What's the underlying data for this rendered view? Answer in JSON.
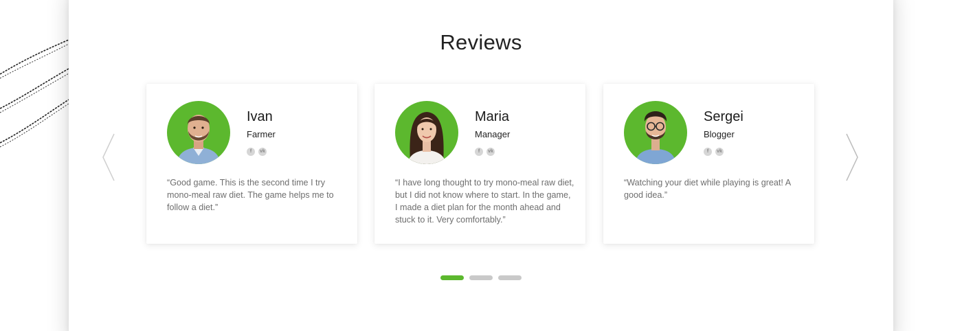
{
  "section": {
    "title": "Reviews"
  },
  "colors": {
    "accent": "#5cb82e",
    "dot_inactive": "#c9c9c9",
    "quote_text": "#6e6e6e",
    "social_icon_bg": "#d6d6d6"
  },
  "reviews": [
    {
      "name": "Ivan",
      "role": "Farmer",
      "quote": "“Good game. This is the second time I try mono-meal raw diet. The game helps me to follow a diet.”",
      "social": [
        "f",
        "vk"
      ]
    },
    {
      "name": "Maria",
      "role": "Manager",
      "quote": "“I have long thought to try mono-meal raw diet, but I did not know where to start. In the game, I made a diet plan for the month ahead and stuck to it. Very comfortably.”",
      "social": [
        "f",
        "vk"
      ]
    },
    {
      "name": "Sergei",
      "role": "Blogger",
      "quote": "“Watching your diet while playing is great! A good idea.”",
      "social": [
        "f",
        "vk"
      ]
    }
  ],
  "carousel": {
    "prev_icon": "chevron-left-icon",
    "next_icon": "chevron-right-icon",
    "page_count": 3,
    "active_page": 1
  }
}
